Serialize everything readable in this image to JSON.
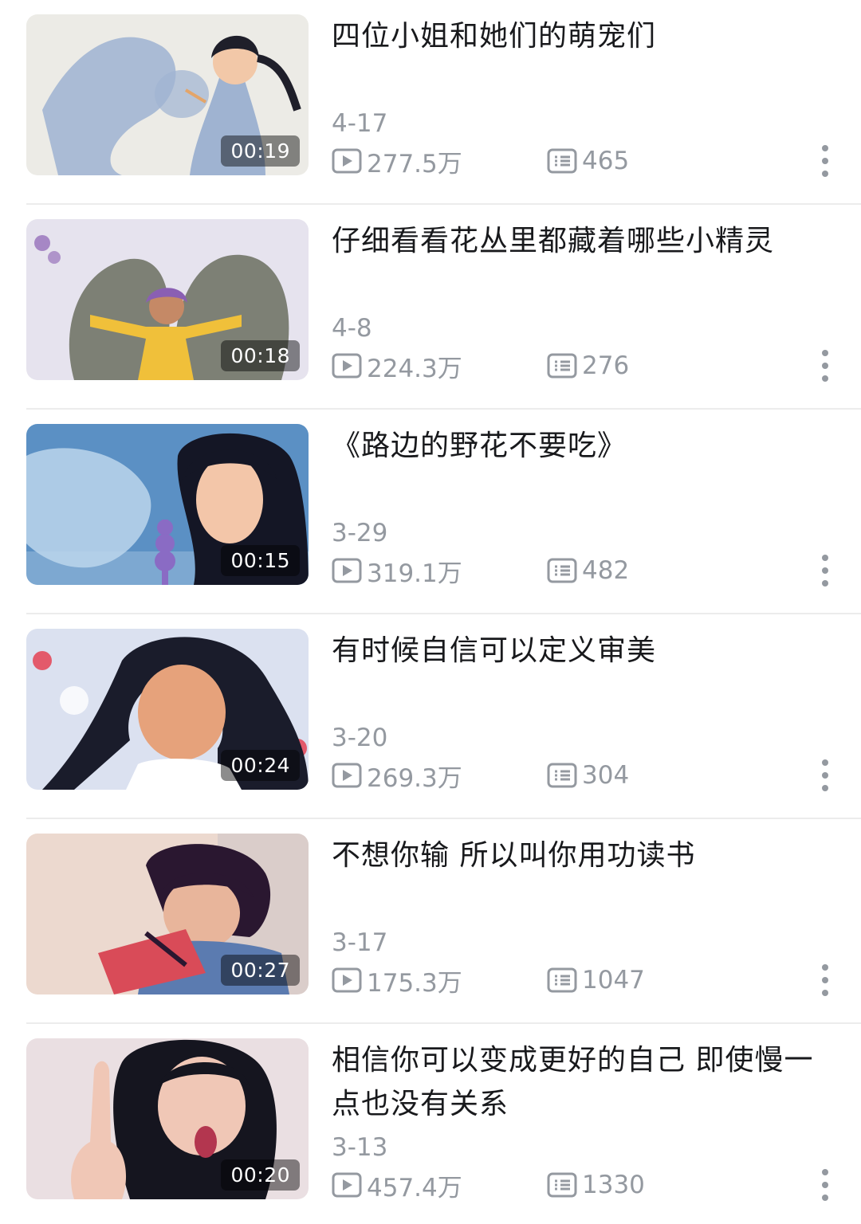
{
  "videos": [
    {
      "title": "四位小姐和她们的萌宠们",
      "duration": "00:19",
      "date": "4-17",
      "plays": "277.5万",
      "danmaku": "465",
      "thumb_colors": {
        "bg": "#ecebe6",
        "accent": "#9fb3d1",
        "figure": "#1f1f2a",
        "skin": "#f2c8a8",
        "extra": "#e3a56a"
      }
    },
    {
      "title": "仔细看看花丛里都藏着哪些小精灵",
      "duration": "00:18",
      "date": "4-8",
      "plays": "224.3万",
      "danmaku": "276",
      "thumb_colors": {
        "bg": "#e6e3ee",
        "accent": "#7d8075",
        "figure": "#f0c03a",
        "skin": "#c58966",
        "extra": "#8a5fb3"
      }
    },
    {
      "title": "《路边的野花不要吃》",
      "duration": "00:15",
      "date": "3-29",
      "plays": "319.1万",
      "danmaku": "482",
      "thumb_colors": {
        "bg": "#5b90c4",
        "accent": "#bcd6ec",
        "figure": "#141625",
        "skin": "#f3c6a9",
        "extra": "#8a6bc4"
      }
    },
    {
      "title": "有时候自信可以定义审美",
      "duration": "00:24",
      "date": "3-20",
      "plays": "269.3万",
      "danmaku": "304",
      "thumb_colors": {
        "bg": "#dbe1f0",
        "accent": "#ffffff",
        "figure": "#1a1c2b",
        "skin": "#e6a27b",
        "extra": "#e35a6b"
      }
    },
    {
      "title": "不想你输 所以叫你用功读书",
      "duration": "00:27",
      "date": "3-17",
      "plays": "175.3万",
      "danmaku": "1047",
      "thumb_colors": {
        "bg": "#ecd9cf",
        "accent": "#5b7bb0",
        "figure": "#2a1730",
        "skin": "#e8b59b",
        "extra": "#d94b58"
      }
    },
    {
      "title": "相信你可以变成更好的自己 即使慢一点也没有关系",
      "duration": "00:20",
      "date": "3-13",
      "plays": "457.4万",
      "danmaku": "1330",
      "thumb_colors": {
        "bg": "#eadfe2",
        "accent": "#ffffff",
        "figure": "#15151f",
        "skin": "#f0c7b6",
        "extra": "#b3364f"
      }
    }
  ]
}
